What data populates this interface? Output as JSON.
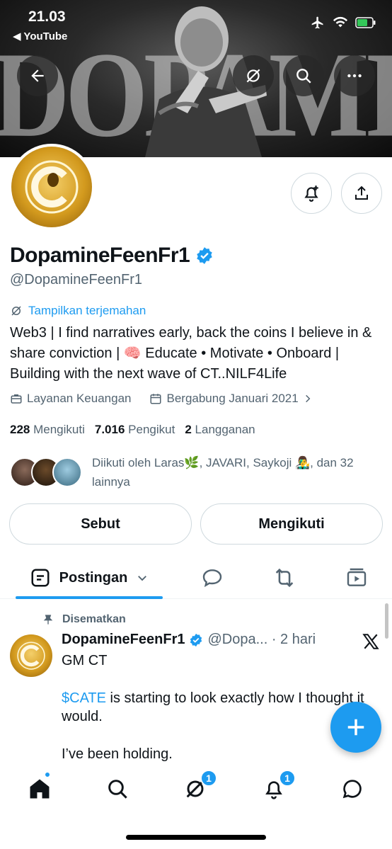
{
  "status_bar": {
    "time": "21.03",
    "back_app": "◀ YouTube"
  },
  "banner": {
    "word": "DOPAMINEFEENLIFE"
  },
  "profile": {
    "display_name": "DopamineFeenFr1",
    "handle": "@DopamineFeenFr1",
    "translate_label": "Tampilkan terjemahan",
    "bio": "Web3 | I find narratives early, back the coins I believe in & share conviction | 🧠 Educate • Motivate • Onboard | Building with the next wave of CT..NILF4Life",
    "category": "Layanan Keuangan",
    "joined": "Bergabung Januari 2021",
    "following_count": "228",
    "following_label": "Mengikuti",
    "followers_count": "7.016",
    "followers_label": "Pengikut",
    "subs_count": "2",
    "subs_label": "Langganan",
    "followed_by": "Diikuti oleh Laras🌿, JAVARI, Saykoji 👨‍🎤, dan 32 lainnya",
    "mention_button": "Sebut",
    "follow_button": "Mengikuti"
  },
  "tabs": {
    "active_label": "Postingan"
  },
  "post": {
    "pinned_label": "Disematkan",
    "author": "DopamineFeenFr1",
    "meta": "@Dopa... · 2 hari",
    "line1": "GM CT",
    "cashtag": "$CATE",
    "line2_rest": " is starting to look exactly how I thought it would.",
    "line3": "I’ve been holding."
  },
  "nav": {
    "grok_badge": "1",
    "notif_badge": "1"
  },
  "colors": {
    "accent": "#1d9bf0",
    "text": "#0f1419",
    "muted": "#536471"
  }
}
